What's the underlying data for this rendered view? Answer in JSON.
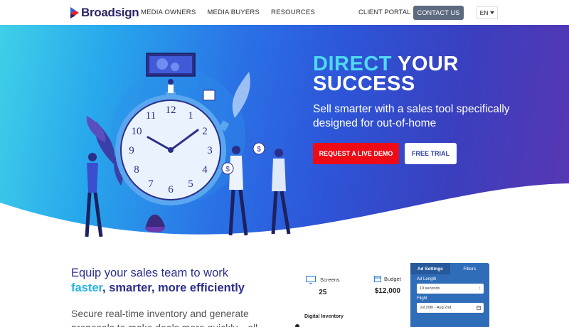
{
  "nav": {
    "logo_text": "Broadsign",
    "links": [
      "MEDIA OWNERS",
      "MEDIA BUYERS",
      "RESOURCES"
    ],
    "client_portal": "CLIENT PORTAL",
    "contact": "CONTACT US",
    "language": "EN"
  },
  "hero": {
    "title_accent": "DIRECT",
    "title_rest": " YOUR",
    "title_line2": "SUCCESS",
    "subtitle": "Sell smarter with a sales tool specifically designed for out-of-home",
    "demo_button": "REQUEST A LIVE DEMO",
    "trial_button": "FREE TRIAL",
    "clock_numbers": [
      "12",
      "1",
      "2",
      "3",
      "4",
      "5",
      "6",
      "7",
      "8",
      "9",
      "10",
      "11"
    ]
  },
  "feature": {
    "title_line1": "Equip your sales team to work",
    "title_hl": "faster",
    "title_rest": ", smarter, more efficiently",
    "body": "Secure real-time inventory and generate proposals to make deals more quickly—all"
  },
  "dashboard": {
    "screens_label": "Screens",
    "screens_value": "25",
    "budget_label": "Budget",
    "budget_value": "$12,000",
    "digital_inventory": "Digital Inventory",
    "tabs": [
      "Ad Settings",
      "Filters"
    ],
    "ad_length_label": "Ad Length",
    "ad_length_value": "10 seconds",
    "flight_label": "Flight",
    "flight_value": "Jul 20th - Aug 2nd"
  },
  "colors": {
    "brand_navy": "#2a2466",
    "accent_cyan": "#4fd9f2",
    "demo_red": "#ee0b16",
    "contact_gray": "#5d6b81"
  }
}
